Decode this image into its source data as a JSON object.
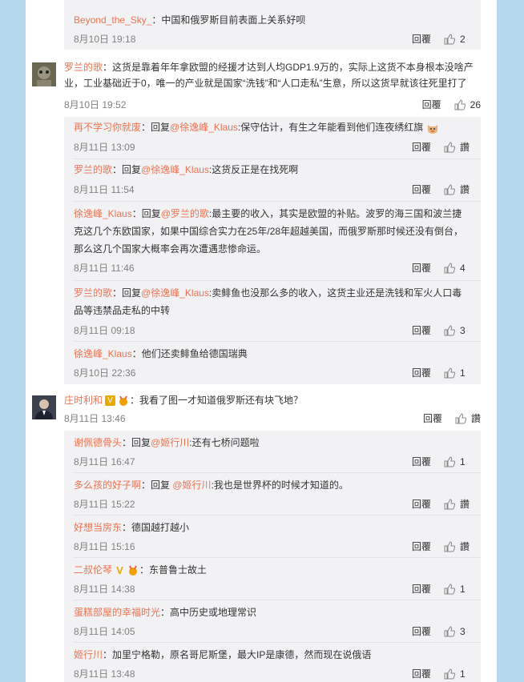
{
  "labels": {
    "reply": "回覆",
    "like_empty": "讚"
  },
  "colors": {
    "accent": "#eb7350",
    "page_bg": "#b6d8ee",
    "reply_bg": "#f2f2f5"
  },
  "threads": [
    {
      "replies": [
        {
          "name": "Beyond_the_Sky_",
          "sep": "：",
          "text": "中国和俄罗斯目前表面上关系好呗",
          "time": "8月10日 19:18",
          "likes": "2"
        }
      ]
    },
    {
      "main": {
        "name": "罗兰的歌",
        "sep": "：",
        "text": "这货是靠着年年拿欧盟的经援才达到人均GDP1.9万的，实际上这货不本身根本没啥产业，工业基础近于0，唯一的产业就是国家“洗钱”和“人口走私”生意，所以这货早就该往死里打了",
        "time": "8月10日 19:52",
        "likes": "26"
      },
      "replies": [
        {
          "name": "再不学习你就废",
          "sep": "：",
          "prefix": "回复",
          "at": "@徐逸峰_Klaus",
          "text": ":保守估计，有生之年能看到他们连夜绣红旗",
          "time": "8月11日 13:09",
          "likes": "讚",
          "emoji": "cat-emoji"
        },
        {
          "name": "罗兰的歌",
          "sep": "：",
          "prefix": "回复",
          "at": "@徐逸峰_Klaus",
          "text": ":这货反正是在找死啊",
          "time": "8月11日 11:54",
          "likes": "讚"
        },
        {
          "name": "徐逸峰_Klaus",
          "sep": "：",
          "prefix": "回复",
          "at": "@罗兰的歌",
          "text": ":最主要的收入，其实是欧盟的补贴。波罗的海三国和波兰捷克这几个东欧国家，如果中国综合实力在25年/28年超越美国，而俄罗斯那时候还没有倒台，那么这几个国家大概率会再次遭遇悲惨命运。",
          "time": "8月11日 11:46",
          "likes": "4"
        },
        {
          "name": "罗兰的歌",
          "sep": "：",
          "prefix": "回复",
          "at": "@徐逸峰_Klaus",
          "text": ":卖鲱鱼也没那么多的收入，这货主业还是洗钱和军火人口毒品等违禁品走私的中转",
          "time": "8月11日 09:18",
          "likes": "3"
        },
        {
          "name": "徐逸峰_Klaus",
          "sep": "：",
          "text": "他们还卖鲱鱼给德国瑞典",
          "time": "8月10日 22:36",
          "likes": "1"
        }
      ]
    },
    {
      "main": {
        "name": "庄时利和",
        "sep": "：",
        "text": "我看了图一才知道俄罗斯还有块飞地？",
        "time": "8月11日 13:46",
        "likes": "讚",
        "vip": "V"
      },
      "replies": [
        {
          "name": "谢佩德骨头",
          "sep": "：",
          "prefix": "回复",
          "at": "@姬行川",
          "text": ":还有七桥问题啦",
          "time": "8月11日 16:47",
          "likes": "1"
        },
        {
          "name": "多么孩的好子啊",
          "sep": "：",
          "prefix": "回复 ",
          "at": "@姬行川",
          "text": ":我也是世界杯的时候才知道的。",
          "time": "8月11日 15:22",
          "likes": "讚"
        },
        {
          "name": "好想当房东",
          "sep": "：",
          "text": "德国越打越小",
          "time": "8月11日 15:16",
          "likes": "讚"
        },
        {
          "name": "二叔伦琴",
          "sep": "：",
          "text": "东普鲁士故土",
          "time": "8月11日 14:38",
          "likes": "1",
          "vip": "V"
        },
        {
          "name": "蛋糕部屋的幸福时光",
          "sep": "：",
          "text": "高中历史或地理常识",
          "time": "8月11日 14:05",
          "likes": "3"
        },
        {
          "name": "姬行川",
          "sep": "：",
          "text": "加里宁格勒，原名哥尼斯堡，最大IP是康德，然而现在说俄语",
          "time": "8月11日 13:48",
          "likes": "1"
        }
      ]
    }
  ]
}
